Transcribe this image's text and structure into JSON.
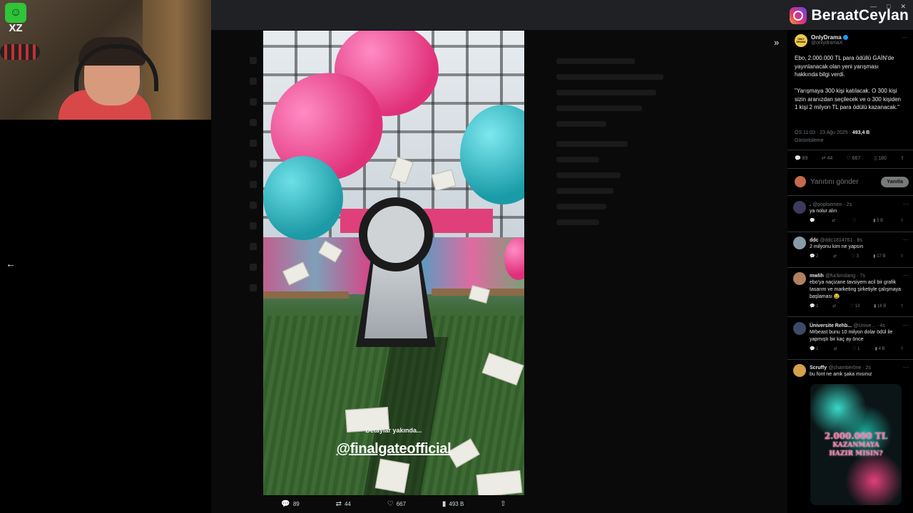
{
  "overlay": {
    "logo_text": "XZ",
    "instagram_handle": "BeraatCeylan"
  },
  "video": {
    "caption_small": "Detaylar yakında...",
    "caption_handle": "@finalgateofficial",
    "actions": {
      "replies": "89",
      "reposts": "44",
      "likes": "667",
      "views": "493 B"
    }
  },
  "post": {
    "author_name": "OnlyDrama",
    "author_handle": "@onlydramaX",
    "avatar_text": "ONLY DRAMA",
    "text": "Ebo, 2.000.000 TL para ödüllü GAİN'de yayınlanacak olan yeni yarışması hakkında bilgi verdi.\n\n\"Yarışmaya 300 kişi katılacak. O 300 kişi sizin aranızdan seçilecek ve o 300 kişiden 1 kişi 2 milyon TL para ödülü kazanacak.\"",
    "time": "ÖS 11:03 · 23 Ağu 2025 ·",
    "views": "493,4 B",
    "views_label": "Görüntüleme",
    "stats": {
      "replies": "89",
      "reposts": "44",
      "likes": "667",
      "bookmarks": "180"
    }
  },
  "reply_box": {
    "placeholder": "Yanıtını gönder",
    "button": "Yanıtla"
  },
  "replies": [
    {
      "name": ".",
      "handle": "@poplsemen · 2s",
      "text": "ya nolur alın",
      "replies": "",
      "reposts": "",
      "likes": "",
      "views": "5 B"
    },
    {
      "name": "ddc",
      "handle": "@ddc1814761 · 8s",
      "text": "2 milyonu kim ne yapsın",
      "replies": "2",
      "reposts": "",
      "likes": "3",
      "views": "17 B"
    },
    {
      "name": "mwlih",
      "handle": "@fuckinslang · 7s",
      "text": "ebo'ya naçizane tavsiyem acil bir grafik tasarım ve marketing şirketiyle çalışmaya başlaması 😂",
      "replies": "1",
      "reposts": "",
      "likes": "13",
      "views": "16 B"
    },
    {
      "name": "Üniversite Rehb...",
      "handle": "@Unive... · 4s",
      "text": "Mrbeast bunu 10 milyon dolar ödül ile yapmıştı bir kaç ay önce",
      "replies": "1",
      "reposts": "",
      "likes": "1",
      "views": "4 B"
    },
    {
      "name": "Scruffy",
      "handle": "@chamber0ne · 2s",
      "text": "bu font ne amk şaka mısınız",
      "replies": "",
      "reposts": "",
      "likes": "",
      "views": ""
    }
  ],
  "media_text": {
    "line1": "2.000.000 TL",
    "line2": "KAZANMAYA",
    "line3": "HAZIR MISIN?"
  }
}
